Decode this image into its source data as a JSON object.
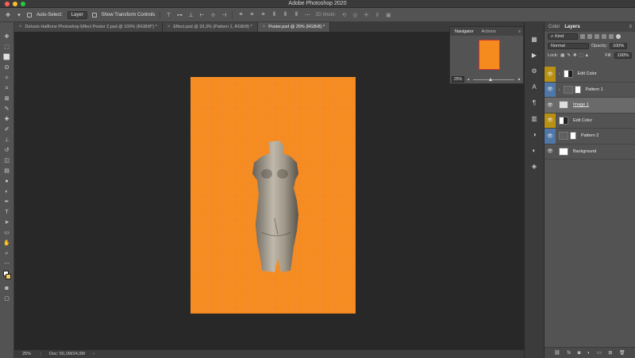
{
  "app": {
    "window_title": "Adobe Photoshop 2020"
  },
  "options_bar": {
    "auto_select_label": "Auto-Select:",
    "auto_select_value": "Layer",
    "show_transform_label": "Show Transform Controls",
    "mode_3d_label": "3D Mode:"
  },
  "tabs": [
    {
      "label": "Deluxio Halftone Photoshop Effect Poster 2.psd @ 100% (RGB/8*) *",
      "active": false
    },
    {
      "label": "Effect.psd @ 33,3% (Pattern 1, RGB/8) *",
      "active": false
    },
    {
      "label": "Poster.psd @ 25% (RGB/8) *",
      "active": true
    }
  ],
  "navigator": {
    "tab_navigator": "Navigator",
    "tab_actions": "Actions",
    "zoom": "25%"
  },
  "status": {
    "zoom": "25%",
    "doc_info": "Doc: 50,1M/24,0M"
  },
  "layers_panel": {
    "tab_color": "Color",
    "tab_layers": "Layers",
    "filter_kind": "Kind",
    "blend_mode": "Normal",
    "opacity_label": "Opacity:",
    "opacity_value": "100%",
    "lock_label": "Lock:",
    "fill_label": "Fill:",
    "fill_value": "100%",
    "layers": [
      {
        "name": "Edit Color",
        "color_tag": "yellow",
        "clipped": true,
        "thumb": "adjust",
        "selected": false
      },
      {
        "name": "Pattern 1",
        "color_tag": "blue",
        "clipped": true,
        "thumb": "pattern",
        "selected": false
      },
      {
        "name": "Image 1",
        "color_tag": "none",
        "clipped": false,
        "thumb": "image",
        "selected": true
      },
      {
        "name": "Edit Color",
        "color_tag": "yellow",
        "clipped": false,
        "thumb": "adjust",
        "selected": false
      },
      {
        "name": "Pattern 2",
        "color_tag": "blue",
        "clipped": false,
        "thumb": "pattern",
        "selected": false
      },
      {
        "name": "Background",
        "color_tag": "none",
        "clipped": false,
        "thumb": "white",
        "selected": false
      }
    ]
  },
  "colors": {
    "poster_orange": "#f58a1f",
    "tag_yellow": "#b89014",
    "tag_blue": "#4f78a8",
    "panel_bg": "#535353",
    "canvas_bg": "#282828"
  }
}
